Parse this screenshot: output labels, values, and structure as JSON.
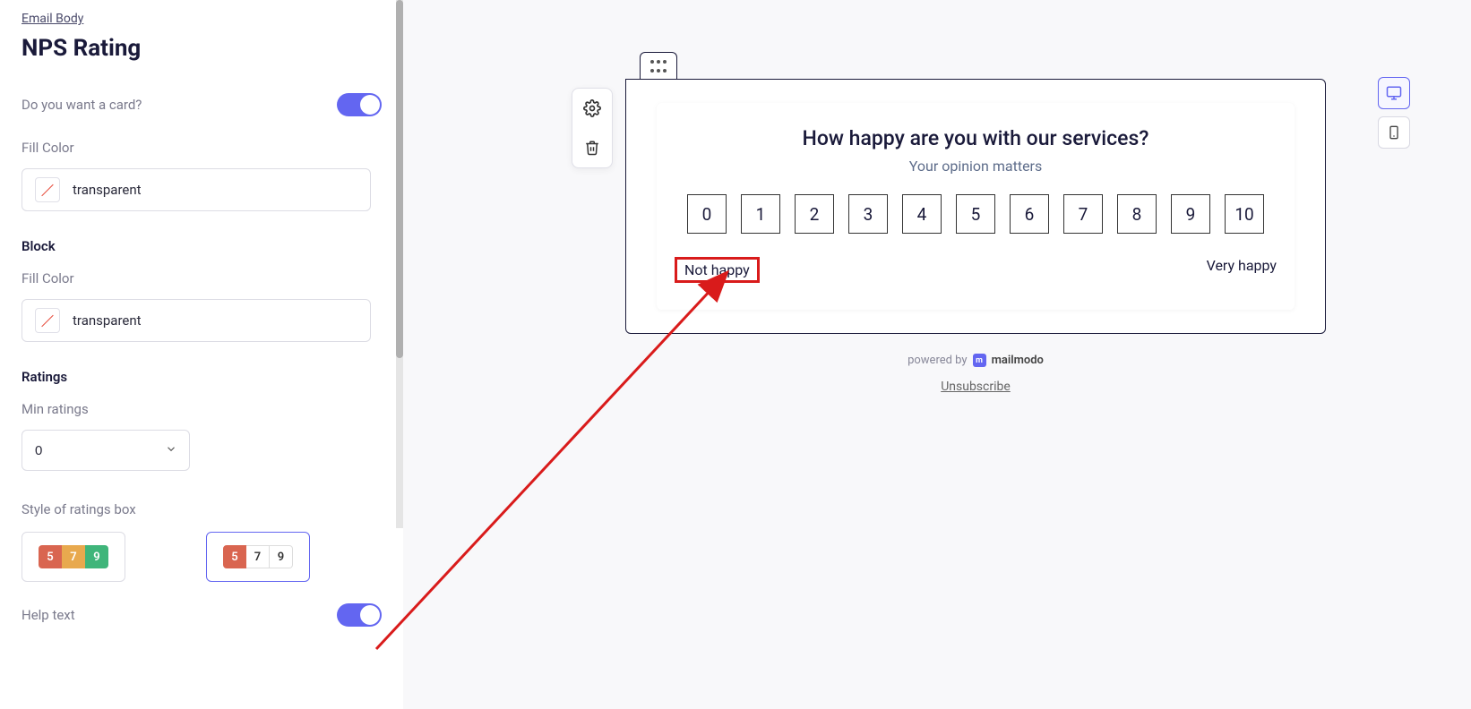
{
  "sidebar": {
    "breadcrumb": "Email Body",
    "title": "NPS Rating",
    "card_toggle_label": "Do you want a card?",
    "card_toggle_on": true,
    "card_fill_label": "Fill Color",
    "card_fill_value": "transparent",
    "block_label": "Block",
    "block_fill_label": "Fill Color",
    "block_fill_value": "transparent",
    "ratings_label": "Ratings",
    "min_ratings_label": "Min ratings",
    "min_ratings_value": "0",
    "style_label": "Style of ratings box",
    "style_solid": [
      "5",
      "7",
      "9"
    ],
    "style_outline": [
      "5",
      "7",
      "9"
    ],
    "style_selected_index": 1,
    "help_text_label": "Help text",
    "help_text_on": true
  },
  "preview": {
    "question": "How happy are you with our services?",
    "sub": "Your opinion matters",
    "ratings": [
      "0",
      "1",
      "2",
      "3",
      "4",
      "5",
      "6",
      "7",
      "8",
      "9",
      "10"
    ],
    "help_left": "Not happy",
    "help_right": "Very happy",
    "powered_prefix": "powered by",
    "powered_brand": "mailmodo",
    "unsubscribe": "Unsubscribe"
  }
}
